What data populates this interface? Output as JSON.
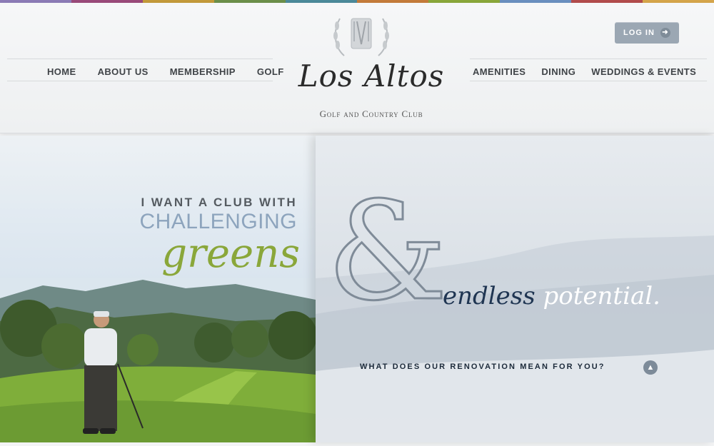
{
  "colors": {
    "strip": [
      "#8c7bb6",
      "#9a4a7a",
      "#c39a3a",
      "#6c8f4a",
      "#4c8a9a",
      "#c47b3a",
      "#8aa73a",
      "#6a8fbf",
      "#b24c4c",
      "#d5a54b"
    ],
    "accent_green": "#8aa73a",
    "navy": "#1f3552"
  },
  "nav_left": [
    "HOME",
    "ABOUT US",
    "MEMBERSHIP",
    "GOLF"
  ],
  "nav_right": [
    "AMENITIES",
    "DINING",
    "WEDDINGS & EVENTS"
  ],
  "login": {
    "label": "LOG IN",
    "icon": "arrow-right-icon"
  },
  "logo": {
    "script": "Los Altos",
    "subtitle": "Golf and Country Club",
    "crest_icon": "laurel-crest-icon"
  },
  "hero": {
    "line1": "I WANT A CLUB WITH",
    "line2": "CHALLENGING",
    "line3": "greens",
    "ampersand": "&",
    "endless": "endless",
    "potential": "potential.",
    "cta": "WHAT DOES OUR RENOVATION MEAN FOR YOU?",
    "cta_icon": "chevron-up-icon"
  }
}
